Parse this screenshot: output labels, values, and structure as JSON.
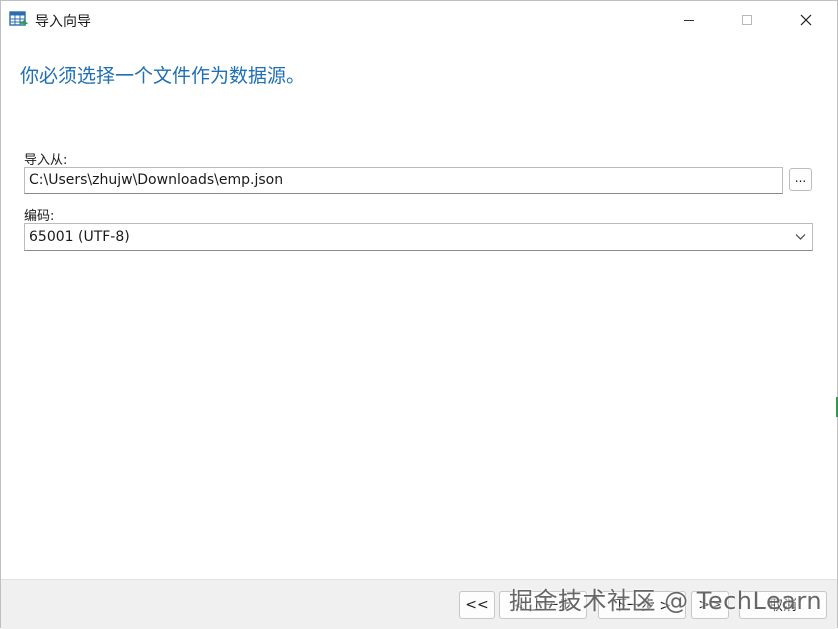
{
  "window": {
    "title": "导入向导",
    "icon": "table-import-icon"
  },
  "page": {
    "heading": "你必须选择一个文件作为数据源。"
  },
  "import_from": {
    "label": "导入从:",
    "value": "C:\\Users\\zhujw\\Downloads\\emp.json",
    "browse_label": "..."
  },
  "encoding": {
    "label": "编码:",
    "selected": "65001 (UTF-8)"
  },
  "footer": {
    "first_label": "<<",
    "prev_label": "< 上一步",
    "next_label": "下一步 >",
    "last_label": ">>",
    "cancel_label": "取消"
  },
  "watermark": "掘金技术社区 @ TechLearn",
  "colors": {
    "heading": "#1e6fb3",
    "footer_bg": "#f0f0f0",
    "icon_blue": "#2b6cb0",
    "icon_green": "#2e9b4f"
  }
}
